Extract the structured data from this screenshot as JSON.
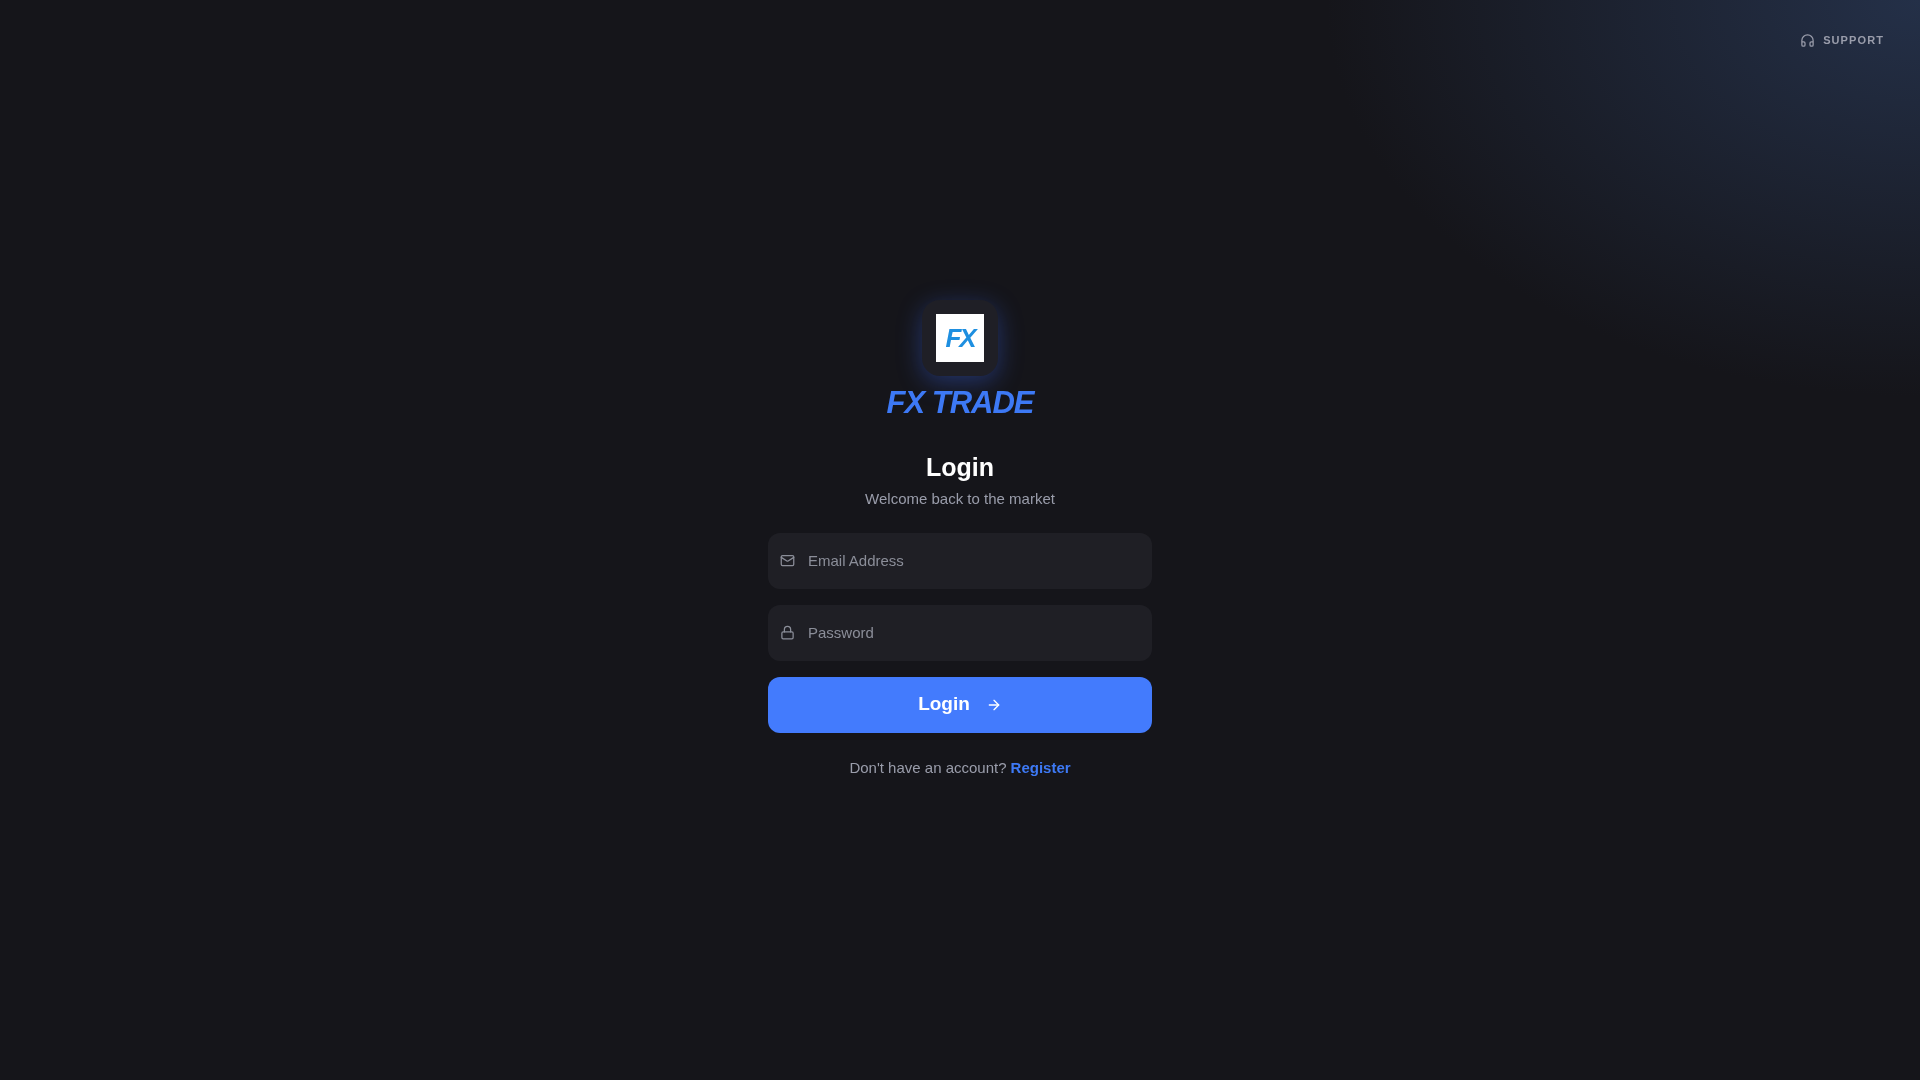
{
  "support": {
    "label": "SUPPORT"
  },
  "logo": {
    "mark": "FX",
    "brand": "FX TRADE"
  },
  "heading": "Login",
  "subheading": "Welcome back to the market",
  "fields": [
    {
      "kind": "email",
      "placeholder": "Email Address"
    },
    {
      "kind": "password",
      "placeholder": "Password"
    }
  ],
  "submit": {
    "label": "Login"
  },
  "footer": {
    "text": "Don't have an account?",
    "link": "Register"
  }
}
